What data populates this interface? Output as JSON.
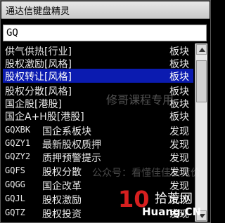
{
  "window": {
    "title": "通达信键盘精灵"
  },
  "search": {
    "value": "GQ"
  },
  "results": [
    {
      "name": "供气供热[行业]",
      "type": "板块",
      "selected": false
    },
    {
      "name": "股权激励[风格]",
      "type": "板块",
      "selected": false
    },
    {
      "name": "股权转让[风格]",
      "type": "板块",
      "selected": true
    },
    {
      "name": "股权分散[风格]",
      "type": "板块",
      "selected": false
    },
    {
      "name": "国企股[港股]",
      "type": "板块",
      "selected": false
    },
    {
      "name": "国企A+H股[港股]",
      "type": "板块",
      "selected": false
    },
    {
      "code": "GQXBK",
      "label": "国企系板块",
      "type": "发现",
      "selected": false
    },
    {
      "code": "GQZY1",
      "label": "最新股权质押",
      "type": "发现",
      "selected": false
    },
    {
      "code": "GQZY2",
      "label": "质押预警提示",
      "type": "发现",
      "selected": false
    },
    {
      "code": "GQFS",
      "label": "股权分散",
      "type": "发现",
      "selected": false
    },
    {
      "code": "GQGG",
      "label": "国企改革",
      "type": "发现",
      "selected": false
    },
    {
      "code": "GQJL",
      "label": "股权激励",
      "type": "发现",
      "selected": false
    },
    {
      "code": "GQTZ",
      "label": "股权投资",
      "type": "发现",
      "selected": false
    }
  ],
  "watermarks": {
    "wechat1": "公众号：看懂佳佳会竞价",
    "wechat2": "公众号：看懂佳佳会竞价",
    "course": "修哥课程专用"
  },
  "logo": {
    "ten": "10",
    "zh": "拾荒网",
    "en": "Huang.CN"
  }
}
